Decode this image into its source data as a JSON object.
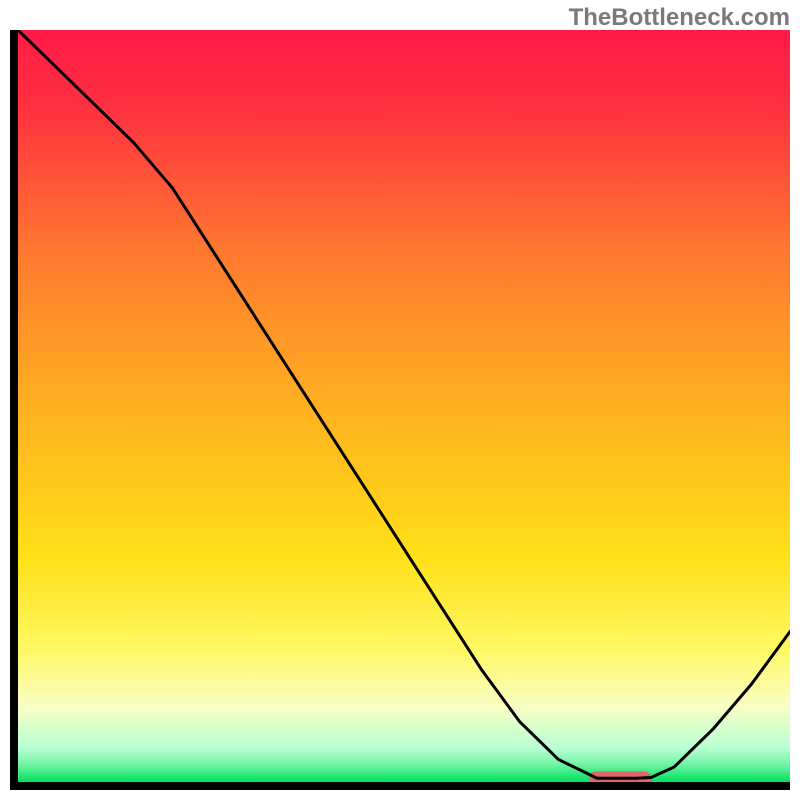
{
  "watermark": "TheBottleneck.com",
  "chart_data": {
    "type": "line",
    "title": "",
    "xlabel": "",
    "ylabel": "",
    "xlim": [
      0,
      100
    ],
    "ylim": [
      0,
      100
    ],
    "series": [
      {
        "name": "bottleneck-curve",
        "x": [
          0,
          5,
          10,
          15,
          20,
          25,
          30,
          35,
          40,
          45,
          50,
          55,
          60,
          65,
          70,
          75,
          80,
          82,
          85,
          90,
          95,
          100
        ],
        "y": [
          100,
          95,
          90,
          85,
          79,
          71,
          63,
          55,
          47,
          39,
          31,
          23,
          15,
          8,
          3,
          0.5,
          0.5,
          0.6,
          2,
          7,
          13,
          20
        ]
      }
    ],
    "marker": {
      "name": "target-marker",
      "x_start": 74,
      "x_end": 82,
      "y": 0.5,
      "color": "#e06666"
    },
    "background_gradient": {
      "stops": [
        {
          "pos": 0.0,
          "color": "#ff1a46"
        },
        {
          "pos": 0.1,
          "color": "#ff3040"
        },
        {
          "pos": 0.3,
          "color": "#ff7a30"
        },
        {
          "pos": 0.5,
          "color": "#ffb020"
        },
        {
          "pos": 0.7,
          "color": "#ffe018"
        },
        {
          "pos": 0.82,
          "color": "#fff860"
        },
        {
          "pos": 0.9,
          "color": "#f8ffc4"
        },
        {
          "pos": 0.955,
          "color": "#b8ffd4"
        },
        {
          "pos": 0.975,
          "color": "#78f5a8"
        },
        {
          "pos": 1.0,
          "color": "#00e060"
        }
      ]
    },
    "grid": false,
    "legend": false
  }
}
